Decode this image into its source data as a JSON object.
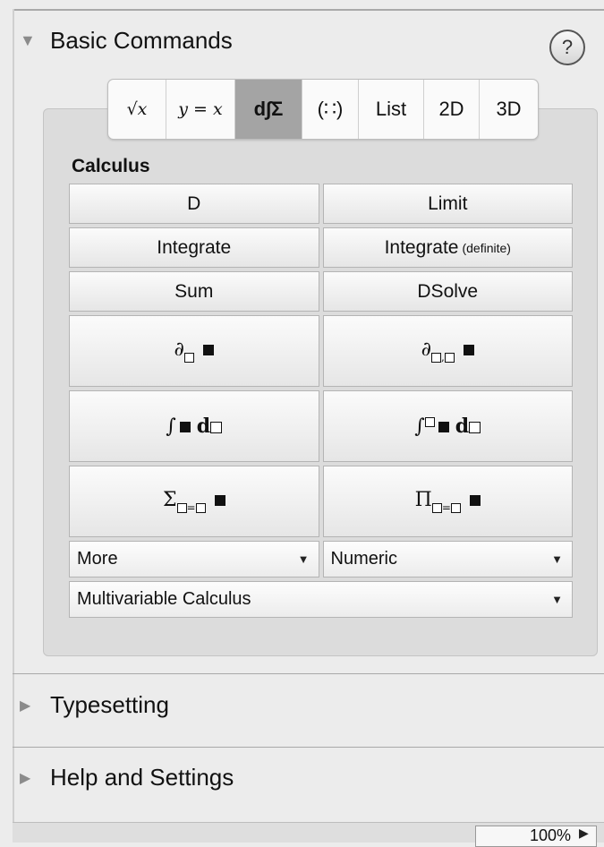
{
  "sections": {
    "basic": {
      "title": "Basic Commands",
      "help": "?"
    },
    "typesetting": {
      "title": "Typesetting"
    },
    "help_settings": {
      "title": "Help and Settings"
    }
  },
  "tabs": [
    {
      "label": "√x",
      "active": false
    },
    {
      "label": "y = x",
      "active": false
    },
    {
      "label": "d∫Σ",
      "active": true
    },
    {
      "label": "(∷)",
      "active": false
    },
    {
      "label": "List",
      "active": false
    },
    {
      "label": "2D",
      "active": false
    },
    {
      "label": "3D",
      "active": false
    }
  ],
  "calculus": {
    "title": "Calculus",
    "buttons": {
      "d": "D",
      "limit": "Limit",
      "integrate": "Integrate",
      "integrate_definite": "Integrate",
      "integrate_definite_note": "(definite)",
      "sum": "Sum",
      "dsolve": "DSolve"
    },
    "dropdowns": {
      "more": "More",
      "numeric": "Numeric",
      "multivariable": "Multivariable Calculus"
    }
  },
  "zoom": "100%",
  "colors": {
    "background": "#ececec",
    "panel": "#dcdcdc",
    "active_tab": "#a4a4a4"
  }
}
